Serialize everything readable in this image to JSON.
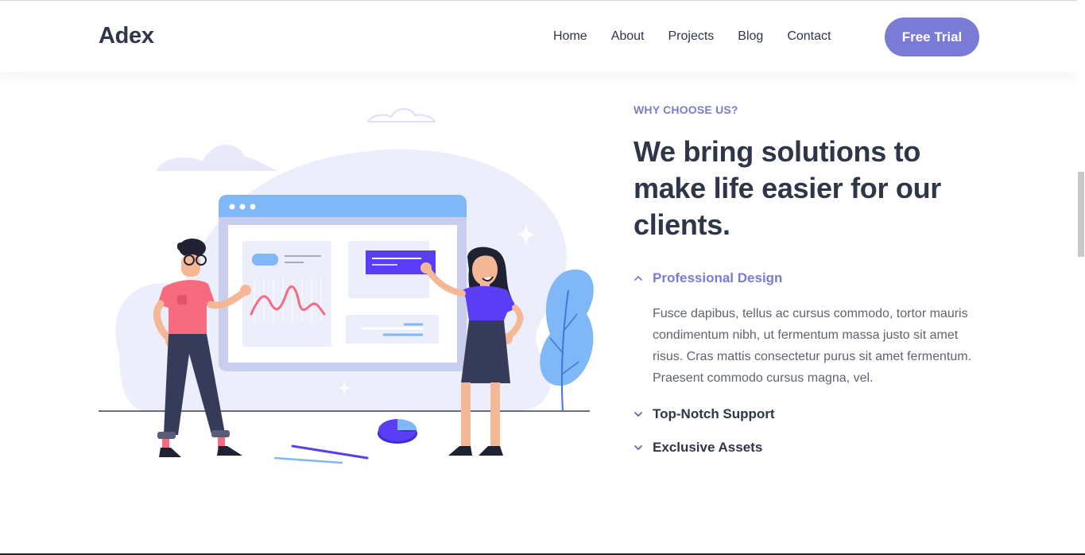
{
  "header": {
    "logo": "Adex",
    "nav": [
      "Home",
      "About",
      "Projects",
      "Blog",
      "Contact"
    ],
    "cta_label": "Free Trial"
  },
  "section": {
    "eyebrow": "WHY CHOOSE US?",
    "heading": "We bring solutions to make life easier for our clients.",
    "accordion": [
      {
        "title": "Professional Design",
        "expanded": true,
        "body": "Fusce dapibus, tellus ac cursus commodo, tortor mauris condimentum nibh, ut fermentum massa justo sit amet risus. Cras mattis consectetur purus sit amet fermentum. Praesent commodo cursus magna, vel."
      },
      {
        "title": "Top-Notch Support",
        "expanded": false
      },
      {
        "title": "Exclusive Assets",
        "expanded": false
      }
    ]
  },
  "colors": {
    "accent": "#7a7bd6",
    "heading": "#2e3648",
    "body_text": "#5f6470",
    "illustration_blob": "#eceefb",
    "illustration_blue": "#80b7f7",
    "illustration_purple": "#5b3df5",
    "illustration_pink": "#f76b80"
  },
  "icons": {
    "accordion_open": "chevron-up-icon",
    "accordion_closed": "chevron-down-icon"
  }
}
